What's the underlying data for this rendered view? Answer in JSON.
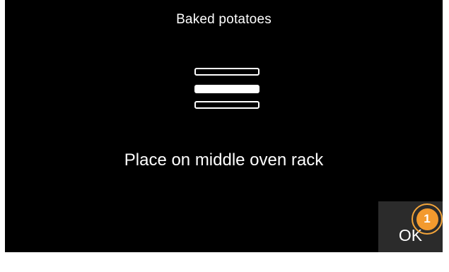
{
  "screen": {
    "title": "Baked potatoes",
    "instruction": "Place on middle oven rack",
    "rack_diagram": {
      "racks": [
        "top",
        "middle",
        "bottom"
      ],
      "highlighted": "middle"
    },
    "ok_label": "OK"
  },
  "annotation": {
    "step_number": "1",
    "color": "#f39a2e"
  },
  "colors": {
    "background": "#000000",
    "text": "#ffffff",
    "button": "#2b2b2b",
    "accent": "#f39a2e"
  }
}
